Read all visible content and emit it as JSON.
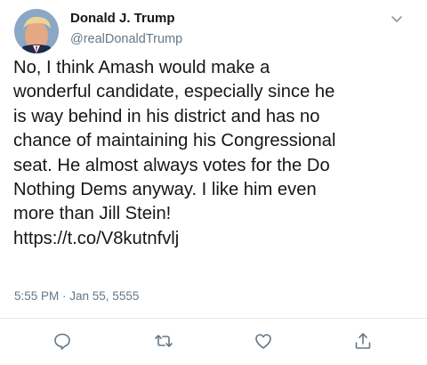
{
  "tweet": {
    "display_name": "Donald J. Trump",
    "handle": "@realDonaldTrump",
    "lines": [
      "No, I think Amash would make a",
      "wonderful candidate, especially since he",
      "is way behind in his district and has no",
      "chance of maintaining his Congressional",
      "seat. He almost always votes for the Do",
      "Nothing Dems anyway. I like him even",
      "more than Jill Stein!",
      "https://t.co/V8kutnfvlj"
    ],
    "timestamp": "5:55 PM · Jan 55, 5555"
  },
  "actions": {
    "icons": [
      "reply-icon",
      "retweet-icon",
      "like-icon",
      "share-icon"
    ]
  },
  "colors": {
    "text": "#14171a",
    "secondary": "#657786",
    "divider": "#e1e8ed"
  }
}
